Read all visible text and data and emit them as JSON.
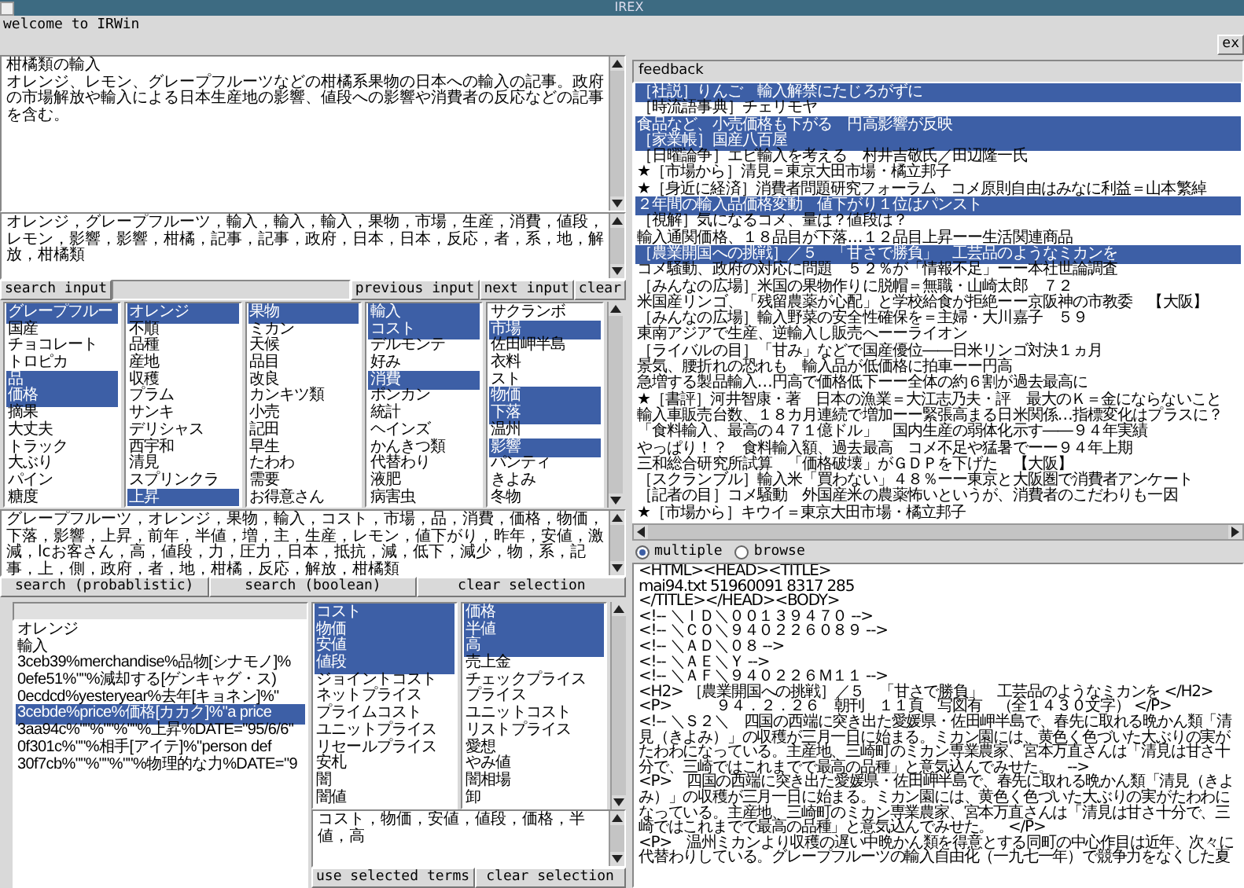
{
  "window": {
    "title": "IREX"
  },
  "welcome": "welcome to IRWin",
  "exit_button": "ex",
  "query": {
    "lines": [
      "柑橘類の輸入",
      "オレンジ、レモン、グレープフルーツなどの柑橘系果物の日本への輸入の記事。政府の市場解放や輸入による日本生産地の影響、値段への影響や消費者の反応などの記事を含む。"
    ]
  },
  "keywords": "オレンジ，グレープフルーツ，輸入，輸入，輸入，果物，市場，生産，消費，値段，レモン，影響，影響，柑橘，記事，記事，政府，日本，日本，反応，者，系，地，解放，柑橘類",
  "input_buttons": [
    "search input",
    "previous input",
    "next input",
    "clear"
  ],
  "term_lists": [
    {
      "items": [
        {
          "label": "グレープフルー",
          "selected": true
        },
        {
          "label": "国産",
          "selected": false
        },
        {
          "label": "チョコレート",
          "selected": false
        },
        {
          "label": "トロピカ",
          "selected": false
        },
        {
          "label": "品",
          "selected": true
        },
        {
          "label": "価格",
          "selected": true
        },
        {
          "label": "摘果",
          "selected": false
        },
        {
          "label": "大丈夫",
          "selected": false
        },
        {
          "label": "トラック",
          "selected": false
        },
        {
          "label": "大ぶり",
          "selected": false
        },
        {
          "label": "パイン",
          "selected": false
        },
        {
          "label": "糖度",
          "selected": false
        }
      ]
    },
    {
      "items": [
        {
          "label": "オレンジ",
          "selected": true
        },
        {
          "label": "不順",
          "selected": false
        },
        {
          "label": "品種",
          "selected": false
        },
        {
          "label": "産地",
          "selected": false
        },
        {
          "label": "収穫",
          "selected": false
        },
        {
          "label": "プラム",
          "selected": false
        },
        {
          "label": "サンキ",
          "selected": false
        },
        {
          "label": "デリシャス",
          "selected": false
        },
        {
          "label": "西宇和",
          "selected": false
        },
        {
          "label": "清見",
          "selected": false
        },
        {
          "label": "スプリンクラ",
          "selected": false
        },
        {
          "label": "上昇",
          "selected": true
        }
      ]
    },
    {
      "items": [
        {
          "label": "果物",
          "selected": true
        },
        {
          "label": "ミカン",
          "selected": false
        },
        {
          "label": "天候",
          "selected": false
        },
        {
          "label": "品目",
          "selected": false
        },
        {
          "label": "改良",
          "selected": false
        },
        {
          "label": "カンキツ類",
          "selected": false
        },
        {
          "label": "小売",
          "selected": false
        },
        {
          "label": "記田",
          "selected": false
        },
        {
          "label": "早生",
          "selected": false
        },
        {
          "label": "たわわ",
          "selected": false
        },
        {
          "label": "需要",
          "selected": false
        },
        {
          "label": "お得意さん",
          "selected": false
        }
      ]
    },
    {
      "items": [
        {
          "label": "輸入",
          "selected": true
        },
        {
          "label": "コスト",
          "selected": true
        },
        {
          "label": "デルモンテ",
          "selected": false
        },
        {
          "label": "好み",
          "selected": false
        },
        {
          "label": "消費",
          "selected": true
        },
        {
          "label": "ポンカン",
          "selected": false
        },
        {
          "label": "統計",
          "selected": false
        },
        {
          "label": "ヘインズ",
          "selected": false
        },
        {
          "label": "かんきつ類",
          "selected": false
        },
        {
          "label": "代替わり",
          "selected": false
        },
        {
          "label": "液肥",
          "selected": false
        },
        {
          "label": "病害虫",
          "selected": false
        }
      ]
    },
    {
      "items": [
        {
          "label": "サクランボ",
          "selected": false
        },
        {
          "label": "市場",
          "selected": true
        },
        {
          "label": "佐田岬半島",
          "selected": false
        },
        {
          "label": "衣料",
          "selected": false
        },
        {
          "label": "スト",
          "selected": false
        },
        {
          "label": "物価",
          "selected": true
        },
        {
          "label": "下落",
          "selected": true
        },
        {
          "label": "温州",
          "selected": false
        },
        {
          "label": "影響",
          "selected": true
        },
        {
          "label": "パンティ",
          "selected": false
        },
        {
          "label": "きよみ",
          "selected": false
        },
        {
          "label": "冬物",
          "selected": false
        }
      ]
    }
  ],
  "terms_text": "グレープフルーツ，オレンジ，果物，輸入，コスト，市場，品，消費，価格，物価，下落，影響，上昇，前年，半値，増，主，生産，レモン，値下がり，昨年，安値，激減，lcお客さん，高，値段，力，圧力，日本，抵抗，減，低下，減少，物，系，記事，上，側，政府，者，地，柑橘，反応，解放，柑橘類",
  "search_buttons": [
    "search (probablistic)",
    "search (boolean)",
    "clear selection"
  ],
  "dictionary": {
    "items": [
      {
        "label": "オレンジ",
        "selected": false
      },
      {
        "label": "輸入",
        "selected": false
      },
      {
        "label": "3ceb39%merchandise%品物[シナモノ]%",
        "selected": false
      },
      {
        "label": "0efe51%\"\"%減却する[ゲンキャグ・ス)",
        "selected": false
      },
      {
        "label": "0ecdcd%yesteryear%去年[キョネン]%\"",
        "selected": false
      },
      {
        "label": "3cebde%price%価格[カカク]%\"a price",
        "selected": true
      },
      {
        "label": "3aa94c%\"\"%\"\"%\"\"%上昇%DATE=\"95/6/6\"",
        "selected": false
      },
      {
        "label": "0f301c%\"\"%相手[アイテ]%\"person def",
        "selected": false
      },
      {
        "label": "30f7cb%\"\"%\"\"%\"\"%物理的な力%DATE=\"9",
        "selected": false
      }
    ]
  },
  "related_lists": [
    {
      "items": [
        {
          "label": "コスト",
          "selected": true
        },
        {
          "label": "物価",
          "selected": true
        },
        {
          "label": "安値",
          "selected": true
        },
        {
          "label": "値段",
          "selected": true
        },
        {
          "label": "ジョイントコスト",
          "selected": false
        },
        {
          "label": "ネットプライス",
          "selected": false
        },
        {
          "label": "プライムコスト",
          "selected": false
        },
        {
          "label": "ユニットプライス",
          "selected": false
        },
        {
          "label": "リセールプライス",
          "selected": false
        },
        {
          "label": "安札",
          "selected": false
        },
        {
          "label": "闇",
          "selected": false
        },
        {
          "label": "闇値",
          "selected": false
        }
      ]
    },
    {
      "items": [
        {
          "label": "価格",
          "selected": true
        },
        {
          "label": "半値",
          "selected": true
        },
        {
          "label": "高",
          "selected": true
        },
        {
          "label": "売上金",
          "selected": false
        },
        {
          "label": "チェックプライス",
          "selected": false
        },
        {
          "label": "プライス",
          "selected": false
        },
        {
          "label": "ユニットコスト",
          "selected": false
        },
        {
          "label": "リストプライス",
          "selected": false
        },
        {
          "label": "愛想",
          "selected": false
        },
        {
          "label": "やみ値",
          "selected": false
        },
        {
          "label": "闇相場",
          "selected": false
        },
        {
          "label": "卸",
          "selected": false
        }
      ]
    }
  ],
  "selected_terms_text": "コスト，物価，安値，値段，価格，半値，高",
  "term_buttons": [
    "use selected terms",
    "clear selection"
  ],
  "feedback": {
    "title": "feedback",
    "items": [
      {
        "label": "［社説］りんご　輸入解禁にたじろがずに",
        "selected": true
      },
      {
        "label": "［時流語事典］チェリモヤ",
        "selected": false
      },
      {
        "label": "食品など、小売価格も下がる　円高影響が反映",
        "selected": true
      },
      {
        "label": "［家業帳］国産八百屋",
        "selected": true
      },
      {
        "label": "［日曜論争］エビ輸入を考える　村井吉敬氏／田辺隆一氏",
        "selected": false
      },
      {
        "label": "★［市場から］清見＝東京大田市場・橘立邦子",
        "selected": false
      },
      {
        "label": "★［身近に経済］消費者問題研究フォーラム　コメ原則自由はみなに利益＝山本繁綽",
        "selected": false
      },
      {
        "label": "２年間の輸入品価格変動　値下がり１位はパンスト",
        "selected": true
      },
      {
        "label": "［視解］気になるコメ、量は？値段は？",
        "selected": false
      },
      {
        "label": "輸入通関価格、１８品目が下落…１２品目上昇ーー生活関連商品",
        "selected": false
      },
      {
        "label": "［農業開国への挑戦］／５　「甘さで勝負」　工芸品のようなミカンを",
        "selected": true
      },
      {
        "label": "コメ騒動、政府の対応に問題　５２％が「情報不足」ーー本社世論調査",
        "selected": false
      },
      {
        "label": "［みんなの広場］米国の果物作りに脱帽＝無職・山崎太郎　７２",
        "selected": false
      },
      {
        "label": "米国産リンゴ、「残留農薬が心配」と学校給食が拒絶ーー京阪神の市教委　【大阪】",
        "selected": false
      },
      {
        "label": "［みんなの広場］輸入野菜の安全性確保を＝主婦・大川嘉子　５９",
        "selected": false
      },
      {
        "label": "東南アジアで生産、逆輸入し販売へーーライオン",
        "selected": false
      },
      {
        "label": "［ライバルの目］「甘み」などで国産優位――日米リンゴ対決１ヵ月",
        "selected": false
      },
      {
        "label": "景気、腰折れの恐れも　輸入品が低価格に拍車ーー円高",
        "selected": false
      },
      {
        "label": "急増する製品輸入…円高で価格低下ーー全体の約６割が過去最高に",
        "selected": false
      },
      {
        "label": "★［書評］河井智康・著　日本の漁業＝大江志乃夫・評　最大のＫ＝金にならないこと",
        "selected": false
      },
      {
        "label": "輸入車販売台数、１８カ月連続で増加ーー緊張高まる日米関係…指標変化はプラスに？",
        "selected": false
      },
      {
        "label": "「食料輸入、最高の４７１億ドル」　国内生産の弱体化示す――９４年実績",
        "selected": false
      },
      {
        "label": "やっぱり！？　食料輸入額、過去最高　コメ不足や猛暑でーー９４年上期",
        "selected": false
      },
      {
        "label": "三和総合研究所試算　「価格破壊」がＧＤＰを下げた　【大阪】",
        "selected": false
      },
      {
        "label": "［スクランブル］輸入米「買わない」４８％ーー東京と大阪圏で消費者アンケート",
        "selected": false
      },
      {
        "label": "［記者の目］コメ騒動　外国産米の農薬怖いというが、消費者のこだわりも一因",
        "selected": false
      },
      {
        "label": "★［市場から］キウイ＝東京大田市場・橘立邦子",
        "selected": false
      }
    ]
  },
  "mode": [
    {
      "label": "multiple",
      "selected": true
    },
    {
      "label": "browse",
      "selected": false
    }
  ],
  "document": {
    "lines": [
      "<HTML><HEAD><TITLE>",
      "mai94.txt 51960091 8317 285",
      "</TITLE></HEAD><BODY>",
      "<!-- ＼ＩＤ＼００１３９４７０ -->",
      "<!-- ＼ＣＯ＼９４０２２６０８９ -->",
      "<!-- ＼ＡＤ＼０８ -->",
      "<!-- ＼ＡＥ＼Ｙ -->",
      "<!-- ＼ＡＦ＼９４０２２６Ｍ１１ -->",
      "<H2> ［農業開国への挑戦］／５　「甘さで勝負」　工芸品のようなミカンを </H2>",
      "<P>　　　９４．２．２６　朝刊　１１頁　写図有　（全１４３０文字） </P>",
      "<!-- ＼Ｓ２＼　四国の西端に突き出た愛媛県・佐田岬半島で、春先に取れる晩かん類「清見（きよみ）」の収穫が三月一日に始まる。ミカン園には、黄色く色づいた大ぶりの実がたわわになっている。主産地、三崎町のミカン専業農家、宮本万直さんは「清見は甘さ十分で、三崎ではこれまでで最高の品種」と意気込んでみせた。　-->",
      "<P>　四国の西端に突き出た愛媛県・佐田岬半島で、春先に取れる晩かん類「清見（きよみ）」の収穫が三月一日に始まる。ミカン園には、黄色く色づいた大ぶりの実がたわわになっている。主産地、三崎町のミカン専業農家、宮本万直さんは「清見は甘さ十分で、三崎ではこれまでで最高の品種」と意気込んでみせた。　</P>",
      "<P>　温州ミカンより収穫の遅い中晩かん類を得意とする同町の中心作目は近年、次々に代替わりしている。グレープフルーツの輸入自由化（一九七一年）で競争力をなくした夏"
    ]
  }
}
